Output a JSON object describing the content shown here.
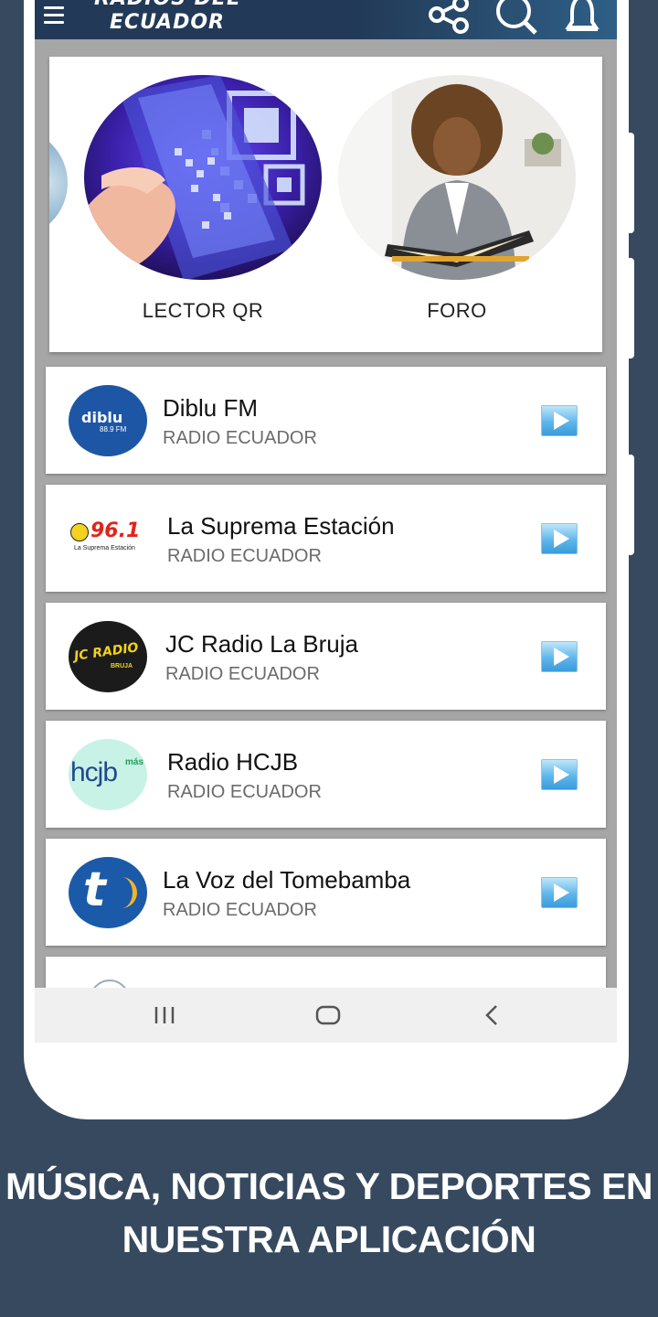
{
  "app": {
    "title_line1": "RADIOS DEL",
    "title_line2": "ECUADOR",
    "menu_icon": "hamburger-menu-icon",
    "actions": [
      "share-icon",
      "search-icon",
      "bell-icon"
    ]
  },
  "featured": [
    {
      "label": "LECTOR QR",
      "image": "qr-phone-image"
    },
    {
      "label": "FORO",
      "image": "woman-reading-image"
    }
  ],
  "stations": [
    {
      "name": "Diblu FM",
      "subtitle": "RADIO ECUADOR",
      "logo_text": "diblu",
      "logo_sub": "88.9 FM"
    },
    {
      "name": "La Suprema Estación",
      "subtitle": "RADIO ECUADOR",
      "logo_text": "96.1",
      "logo_sub": "La Suprema Estación"
    },
    {
      "name": "JC Radio La Bruja",
      "subtitle": "RADIO ECUADOR",
      "logo_text": "JC RADIO",
      "logo_sub": "BRUJA"
    },
    {
      "name": "Radio HCJB",
      "subtitle": "RADIO ECUADOR",
      "logo_text": "hcjb",
      "logo_sub": "más"
    },
    {
      "name": "La Voz del Tomebamba",
      "subtitle": "RADIO ECUADOR",
      "logo_text": "t",
      "logo_sub": ""
    }
  ],
  "navigation": [
    "recent-apps-icon",
    "home-icon",
    "back-icon"
  ],
  "tagline": {
    "line1": "MÚSICA, NOTICIAS Y DEPORTES EN",
    "line2": "NUESTRA APLICACIÓN"
  },
  "colors": {
    "background": "#36495f",
    "appbar": "#223a57",
    "play_button": "#5fb6ea",
    "diblu": "#1e56a6",
    "hcjb": "#c9f2e6"
  }
}
